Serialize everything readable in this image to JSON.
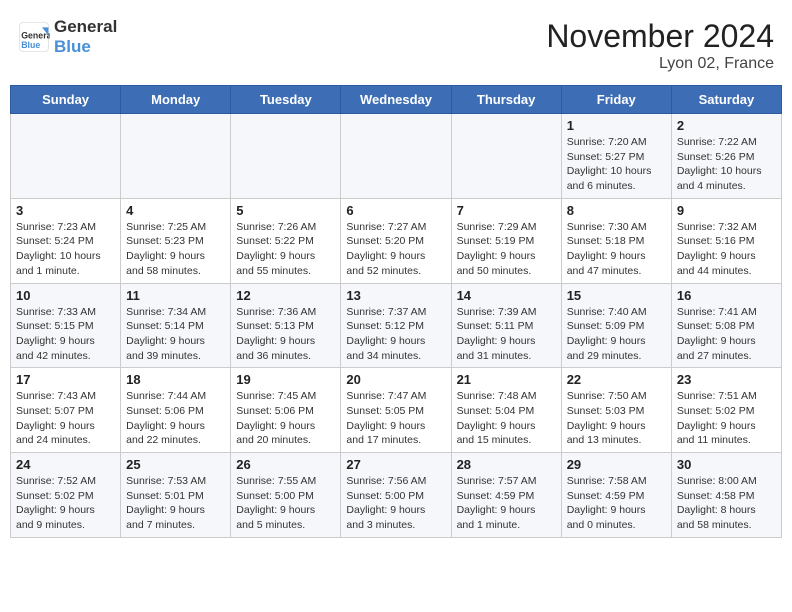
{
  "header": {
    "logo_general": "General",
    "logo_blue": "Blue",
    "month_title": "November 2024",
    "location": "Lyon 02, France"
  },
  "weekdays": [
    "Sunday",
    "Monday",
    "Tuesday",
    "Wednesday",
    "Thursday",
    "Friday",
    "Saturday"
  ],
  "weeks": [
    [
      {
        "day": "",
        "info": ""
      },
      {
        "day": "",
        "info": ""
      },
      {
        "day": "",
        "info": ""
      },
      {
        "day": "",
        "info": ""
      },
      {
        "day": "",
        "info": ""
      },
      {
        "day": "1",
        "info": "Sunrise: 7:20 AM\nSunset: 5:27 PM\nDaylight: 10 hours\nand 6 minutes."
      },
      {
        "day": "2",
        "info": "Sunrise: 7:22 AM\nSunset: 5:26 PM\nDaylight: 10 hours\nand 4 minutes."
      }
    ],
    [
      {
        "day": "3",
        "info": "Sunrise: 7:23 AM\nSunset: 5:24 PM\nDaylight: 10 hours\nand 1 minute."
      },
      {
        "day": "4",
        "info": "Sunrise: 7:25 AM\nSunset: 5:23 PM\nDaylight: 9 hours\nand 58 minutes."
      },
      {
        "day": "5",
        "info": "Sunrise: 7:26 AM\nSunset: 5:22 PM\nDaylight: 9 hours\nand 55 minutes."
      },
      {
        "day": "6",
        "info": "Sunrise: 7:27 AM\nSunset: 5:20 PM\nDaylight: 9 hours\nand 52 minutes."
      },
      {
        "day": "7",
        "info": "Sunrise: 7:29 AM\nSunset: 5:19 PM\nDaylight: 9 hours\nand 50 minutes."
      },
      {
        "day": "8",
        "info": "Sunrise: 7:30 AM\nSunset: 5:18 PM\nDaylight: 9 hours\nand 47 minutes."
      },
      {
        "day": "9",
        "info": "Sunrise: 7:32 AM\nSunset: 5:16 PM\nDaylight: 9 hours\nand 44 minutes."
      }
    ],
    [
      {
        "day": "10",
        "info": "Sunrise: 7:33 AM\nSunset: 5:15 PM\nDaylight: 9 hours\nand 42 minutes."
      },
      {
        "day": "11",
        "info": "Sunrise: 7:34 AM\nSunset: 5:14 PM\nDaylight: 9 hours\nand 39 minutes."
      },
      {
        "day": "12",
        "info": "Sunrise: 7:36 AM\nSunset: 5:13 PM\nDaylight: 9 hours\nand 36 minutes."
      },
      {
        "day": "13",
        "info": "Sunrise: 7:37 AM\nSunset: 5:12 PM\nDaylight: 9 hours\nand 34 minutes."
      },
      {
        "day": "14",
        "info": "Sunrise: 7:39 AM\nSunset: 5:11 PM\nDaylight: 9 hours\nand 31 minutes."
      },
      {
        "day": "15",
        "info": "Sunrise: 7:40 AM\nSunset: 5:09 PM\nDaylight: 9 hours\nand 29 minutes."
      },
      {
        "day": "16",
        "info": "Sunrise: 7:41 AM\nSunset: 5:08 PM\nDaylight: 9 hours\nand 27 minutes."
      }
    ],
    [
      {
        "day": "17",
        "info": "Sunrise: 7:43 AM\nSunset: 5:07 PM\nDaylight: 9 hours\nand 24 minutes."
      },
      {
        "day": "18",
        "info": "Sunrise: 7:44 AM\nSunset: 5:06 PM\nDaylight: 9 hours\nand 22 minutes."
      },
      {
        "day": "19",
        "info": "Sunrise: 7:45 AM\nSunset: 5:06 PM\nDaylight: 9 hours\nand 20 minutes."
      },
      {
        "day": "20",
        "info": "Sunrise: 7:47 AM\nSunset: 5:05 PM\nDaylight: 9 hours\nand 17 minutes."
      },
      {
        "day": "21",
        "info": "Sunrise: 7:48 AM\nSunset: 5:04 PM\nDaylight: 9 hours\nand 15 minutes."
      },
      {
        "day": "22",
        "info": "Sunrise: 7:50 AM\nSunset: 5:03 PM\nDaylight: 9 hours\nand 13 minutes."
      },
      {
        "day": "23",
        "info": "Sunrise: 7:51 AM\nSunset: 5:02 PM\nDaylight: 9 hours\nand 11 minutes."
      }
    ],
    [
      {
        "day": "24",
        "info": "Sunrise: 7:52 AM\nSunset: 5:02 PM\nDaylight: 9 hours\nand 9 minutes."
      },
      {
        "day": "25",
        "info": "Sunrise: 7:53 AM\nSunset: 5:01 PM\nDaylight: 9 hours\nand 7 minutes."
      },
      {
        "day": "26",
        "info": "Sunrise: 7:55 AM\nSunset: 5:00 PM\nDaylight: 9 hours\nand 5 minutes."
      },
      {
        "day": "27",
        "info": "Sunrise: 7:56 AM\nSunset: 5:00 PM\nDaylight: 9 hours\nand 3 minutes."
      },
      {
        "day": "28",
        "info": "Sunrise: 7:57 AM\nSunset: 4:59 PM\nDaylight: 9 hours\nand 1 minute."
      },
      {
        "day": "29",
        "info": "Sunrise: 7:58 AM\nSunset: 4:59 PM\nDaylight: 9 hours\nand 0 minutes."
      },
      {
        "day": "30",
        "info": "Sunrise: 8:00 AM\nSunset: 4:58 PM\nDaylight: 8 hours\nand 58 minutes."
      }
    ]
  ]
}
